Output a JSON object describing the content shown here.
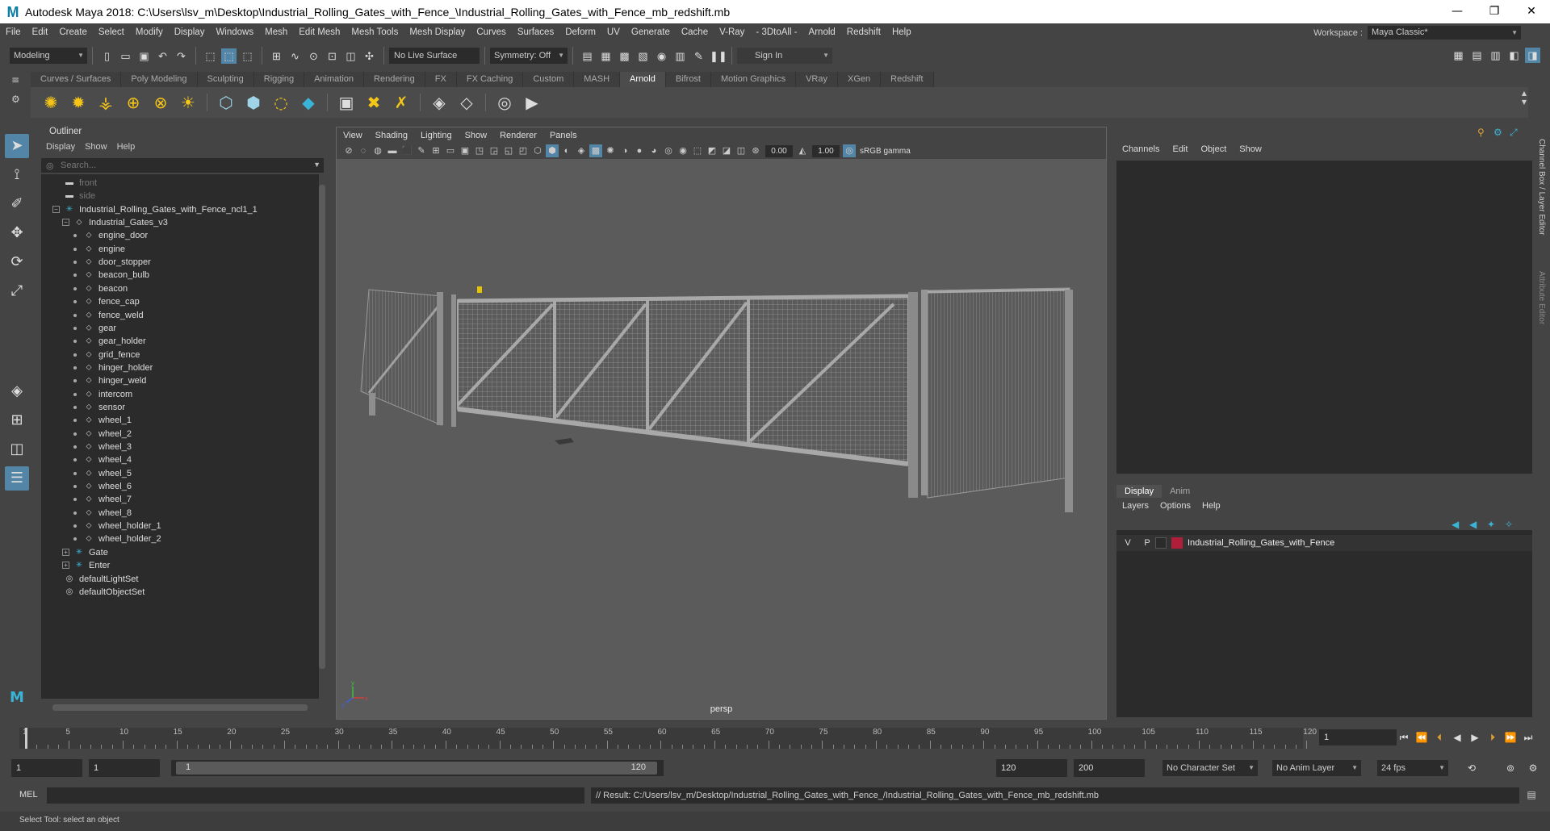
{
  "window": {
    "title": "Autodesk Maya 2018: C:\\Users\\lsv_m\\Desktop\\Industrial_Rolling_Gates_with_Fence_\\Industrial_Rolling_Gates_with_Fence_mb_redshift.mb",
    "logo": "M",
    "minimize_glyph": "—",
    "restore_glyph": "❐",
    "close_glyph": "✕"
  },
  "menubar": {
    "items": [
      "File",
      "Edit",
      "Create",
      "Select",
      "Modify",
      "Display",
      "Windows",
      "Mesh",
      "Edit Mesh",
      "Mesh Tools",
      "Mesh Display",
      "Curves",
      "Surfaces",
      "Deform",
      "UV",
      "Generate",
      "Cache",
      "V-Ray",
      "- 3DtoAll -",
      "Arnold",
      "Redshift",
      "Help"
    ],
    "workspace_label": "Workspace :",
    "workspace_value": "Maya Classic*"
  },
  "statusline": {
    "mode": "Modeling",
    "live_surface": "No Live Surface",
    "symmetry": "Symmetry: Off",
    "sign_in": "Sign In"
  },
  "shelf": {
    "tabs": [
      "Curves / Surfaces",
      "Poly Modeling",
      "Sculpting",
      "Rigging",
      "Animation",
      "Rendering",
      "FX",
      "FX Caching",
      "Custom",
      "MASH",
      "Arnold",
      "Bifrost",
      "Motion Graphics",
      "VRay",
      "XGen",
      "Redshift"
    ],
    "active_tab": "Arnold"
  },
  "outliner": {
    "title": "Outliner",
    "menu": [
      "Display",
      "Show",
      "Help"
    ],
    "search_placeholder": "Search...",
    "nodes": [
      {
        "label": "front",
        "kind": "camera",
        "level": 1,
        "dim": true
      },
      {
        "label": "side",
        "kind": "camera",
        "level": 1,
        "dim": true
      },
      {
        "label": "Industrial_Rolling_Gates_with_Fence_ncl1_1",
        "kind": "joint",
        "level": 1,
        "expander": "minus"
      },
      {
        "label": "Industrial_Gates_v3",
        "kind": "transform",
        "level": 2,
        "expander": "minus"
      },
      {
        "label": "engine_door",
        "kind": "transform",
        "level": 3
      },
      {
        "label": "engine",
        "kind": "transform",
        "level": 3
      },
      {
        "label": "door_stopper",
        "kind": "transform",
        "level": 3
      },
      {
        "label": "beacon_bulb",
        "kind": "transform",
        "level": 3
      },
      {
        "label": "beacon",
        "kind": "transform",
        "level": 3
      },
      {
        "label": "fence_cap",
        "kind": "transform",
        "level": 3
      },
      {
        "label": "fence_weld",
        "kind": "transform",
        "level": 3
      },
      {
        "label": "gear",
        "kind": "transform",
        "level": 3
      },
      {
        "label": "gear_holder",
        "kind": "transform",
        "level": 3
      },
      {
        "label": "grid_fence",
        "kind": "transform",
        "level": 3
      },
      {
        "label": "hinger_holder",
        "kind": "transform",
        "level": 3
      },
      {
        "label": "hinger_weld",
        "kind": "transform",
        "level": 3
      },
      {
        "label": "intercom",
        "kind": "transform",
        "level": 3
      },
      {
        "label": "sensor",
        "kind": "transform",
        "level": 3
      },
      {
        "label": "wheel_1",
        "kind": "transform",
        "level": 3
      },
      {
        "label": "wheel_2",
        "kind": "transform",
        "level": 3
      },
      {
        "label": "wheel_3",
        "kind": "transform",
        "level": 3
      },
      {
        "label": "wheel_4",
        "kind": "transform",
        "level": 3
      },
      {
        "label": "wheel_5",
        "kind": "transform",
        "level": 3
      },
      {
        "label": "wheel_6",
        "kind": "transform",
        "level": 3
      },
      {
        "label": "wheel_7",
        "kind": "transform",
        "level": 3
      },
      {
        "label": "wheel_8",
        "kind": "transform",
        "level": 3
      },
      {
        "label": "wheel_holder_1",
        "kind": "transform",
        "level": 3
      },
      {
        "label": "wheel_holder_2",
        "kind": "transform",
        "level": 3
      },
      {
        "label": "Gate",
        "kind": "joint",
        "level": 2,
        "expander": "plus"
      },
      {
        "label": "Enter",
        "kind": "joint",
        "level": 2,
        "expander": "plus"
      },
      {
        "label": "defaultLightSet",
        "kind": "set",
        "level": 1
      },
      {
        "label": "defaultObjectSet",
        "kind": "set",
        "level": 1
      }
    ]
  },
  "viewport": {
    "menu": [
      "View",
      "Shading",
      "Lighting",
      "Show",
      "Renderer",
      "Panels"
    ],
    "exposure": "0.00",
    "gamma": "1.00",
    "color_space": "sRGB gamma",
    "camera_label": "persp",
    "axis_x": "x",
    "axis_y": "y",
    "axis_z": "z"
  },
  "channelbox": {
    "menu": [
      "Channels",
      "Edit",
      "Object",
      "Show"
    ],
    "layer_tabs": [
      "Display",
      "Anim"
    ],
    "layer_menu": [
      "Layers",
      "Options",
      "Help"
    ],
    "layer": {
      "visible": "V",
      "playback": "P",
      "name": "Industrial_Rolling_Gates_with_Fence",
      "color": "#b01e3a"
    },
    "side_tabs": [
      "Channel Box / Layer Editor",
      "Attribute Editor"
    ]
  },
  "timeslider": {
    "labels": [
      "1",
      "5",
      "10",
      "15",
      "20",
      "25",
      "30",
      "35",
      "40",
      "45",
      "50",
      "55",
      "60",
      "65",
      "70",
      "75",
      "80",
      "85",
      "90",
      "95",
      "100",
      "105",
      "110",
      "115",
      "120"
    ],
    "current_frame": "1"
  },
  "rangeslider": {
    "start": "1",
    "playback_start": "1",
    "range_start": "1",
    "range_end": "120",
    "playback_end": "120",
    "end": "200",
    "character_set": "No Character Set",
    "anim_layer": "No Anim Layer",
    "fps": "24 fps"
  },
  "cmdline": {
    "label": "MEL",
    "result": "// Result: C:/Users/lsv_m/Desktop/Industrial_Rolling_Gates_with_Fence_/Industrial_Rolling_Gates_with_Fence_mb_redshift.mb"
  },
  "helpline": {
    "text": "Select Tool: select an object"
  },
  "colors": {
    "accent": "#5285a6",
    "panel": "#444444",
    "field": "#2b2b2b",
    "viewport_bg": "#5b5b5b"
  }
}
